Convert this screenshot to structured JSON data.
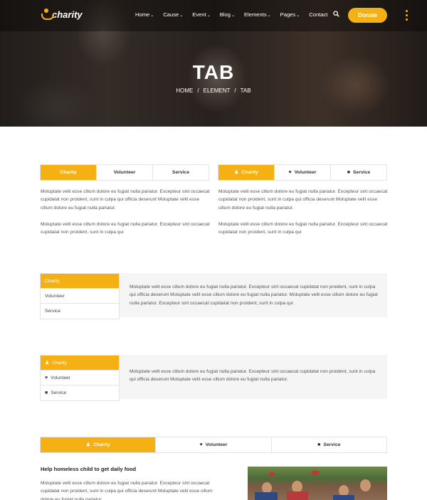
{
  "nav": {
    "logo": "charity",
    "menu": [
      {
        "label": "Home",
        "dropdown": true
      },
      {
        "label": "Cause",
        "dropdown": true
      },
      {
        "label": "Event",
        "dropdown": true
      },
      {
        "label": "Blog",
        "dropdown": true
      },
      {
        "label": "Elements",
        "dropdown": true
      },
      {
        "label": "Pages",
        "dropdown": true
      },
      {
        "label": "Contact",
        "dropdown": false
      }
    ],
    "donate": "Donate",
    "accent": "#f5b014"
  },
  "hero": {
    "title": "TAB",
    "breadcrumb": [
      "HOME",
      "ELEMENT",
      "TAB"
    ],
    "sep": "/"
  },
  "tabs1": {
    "items": [
      "Charity",
      "Volunteer",
      "Service"
    ],
    "p1": "Moluptate velit esse cillum dolore eu fugiat nulla pariatur. Excepteur sint occaecat cupidatat non proident, sunt in culpa qui officia deserunt Moluptate velit esse cillum dolore eu fugiat nulla pariatur.",
    "p2": "Moluptate velit esse cillum dolore eu fugiat nulla pariatur. Excepteur sint occaecat cupidatat non proident, sunt in culpa qui"
  },
  "tabs2": {
    "items": [
      {
        "label": "Charity",
        "icon": "user-icon"
      },
      {
        "label": "Volunteer",
        "icon": "heart-icon"
      },
      {
        "label": "Service",
        "icon": "folder-icon"
      }
    ],
    "p1": "Moluptate velit esse cillum dolore eu fugiat nulla pariatur. Excepteur sint occaecat cupidatat non proident, sunt in culpa qui officia deserunt Moluptate velit esse cillum dolore eu fugiat nulla pariatur.",
    "p2": "Moluptate velit esse cillum dolore eu fugiat nulla pariatur. Excepteur sint occaecat cupidatat non proident, sunt in culpa qui"
  },
  "tabs3": {
    "items": [
      "Charity",
      "Volunteer",
      "Service"
    ],
    "text": "Moluptate velit esse cillum dolore eu fugiat nulla pariatur. Excepteur sint occaecat cupidatat non proident, sunt in culpa qui officia deserunt Moluptate velit esse cillum dolore eu fugiat nulla pariatur. Moluptate velit esse cillum dolore eu fugiat nulla pariatur. Excepteur sint occaecat cupidatat non proident, sunt in culpa qui"
  },
  "tabs4": {
    "items": [
      {
        "label": "Charity",
        "icon": "user-icon"
      },
      {
        "label": "Volunteer",
        "icon": "heart-icon"
      },
      {
        "label": "Service",
        "icon": "folder-icon"
      }
    ],
    "text": "Moluptate velit esse cillum dolore eu fugiat nulla pariatur. Excepteur sint occaecat cupidatat non proident, sunt in culpa qui officia deserunt Moluptate velit esse cillum dolore eu fugiat nulla pariatur."
  },
  "tabs5": {
    "items": [
      {
        "label": "Charity",
        "icon": "user-icon"
      },
      {
        "label": "Volunteer",
        "icon": "heart-icon"
      },
      {
        "label": "Service",
        "icon": "folder-icon"
      }
    ],
    "heading": "Help homeless child to get daily food",
    "text": "Moluptate velit esse cillum dolore eu fugiat nulla pariatur. Excepteur sint occaecat cupidatat non proident, sunt in culpa qui officia deserunt Moluptate velit esse cillum dolore eu fugiat nulla pariatur."
  }
}
